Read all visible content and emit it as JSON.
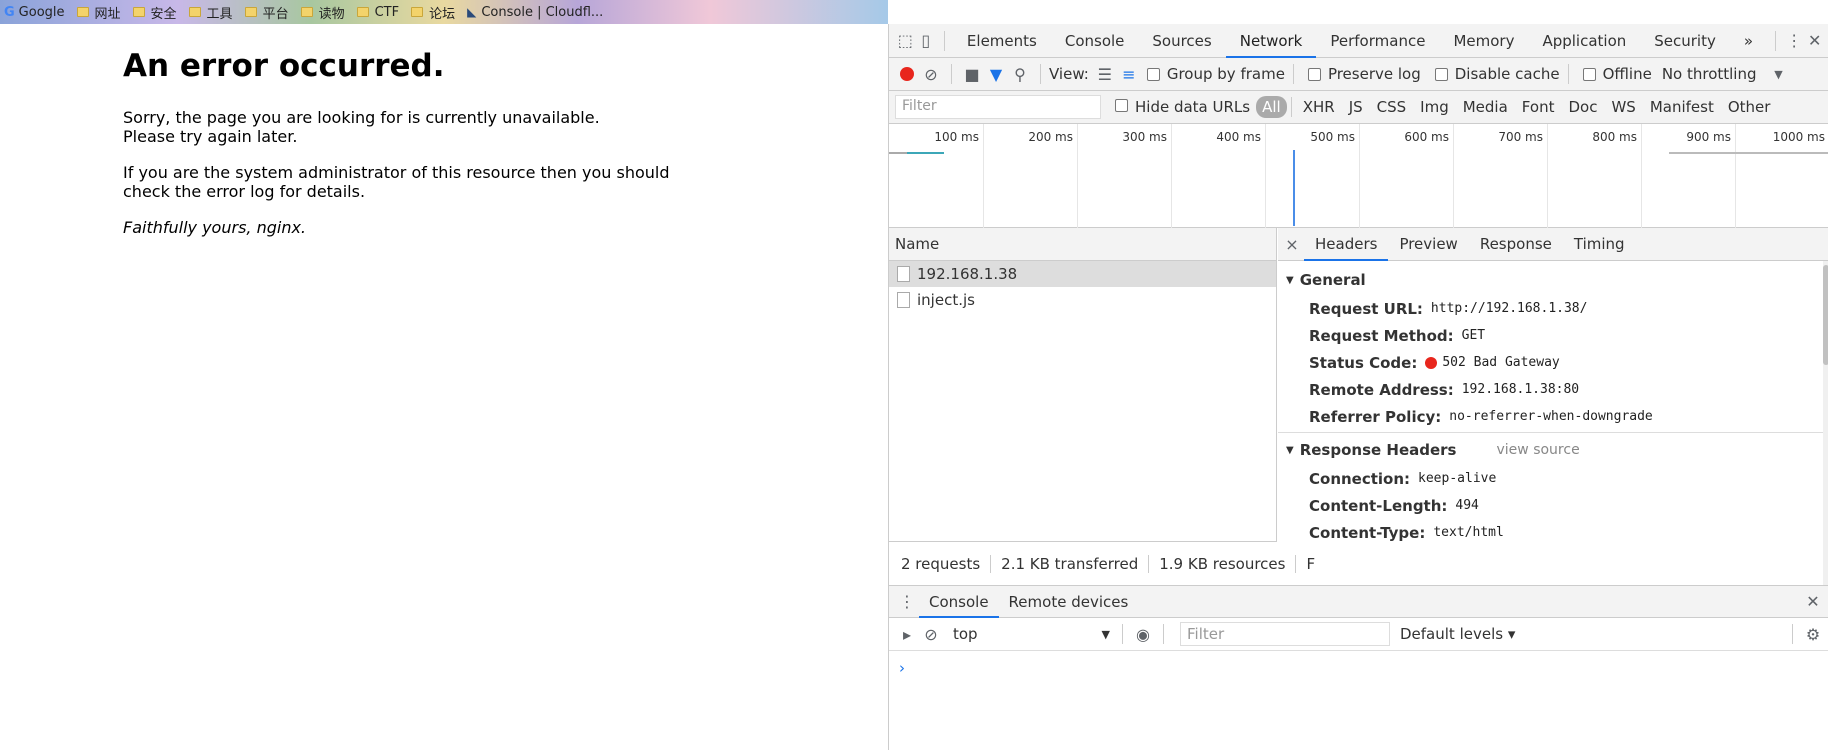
{
  "bookmarks": [
    {
      "label": "Google",
      "icon": "google-icon"
    },
    {
      "label": "网址",
      "icon": "folder-icon"
    },
    {
      "label": "安全",
      "icon": "folder-icon"
    },
    {
      "label": "工具",
      "icon": "folder-icon"
    },
    {
      "label": "平台",
      "icon": "folder-icon"
    },
    {
      "label": "读物",
      "icon": "folder-icon"
    },
    {
      "label": "CTF",
      "icon": "folder-icon"
    },
    {
      "label": "论坛",
      "icon": "folder-icon"
    },
    {
      "label": "Console | Cloudfl...",
      "icon": "cloudflare-icon"
    }
  ],
  "page": {
    "title": "An error occurred.",
    "p1": "Sorry, the page you are looking for is currently unavailable.",
    "p1b": "Please try again later.",
    "p2": "If you are the system administrator of this resource then you should check the error log for details.",
    "p3": "Faithfully yours, nginx."
  },
  "devtools": {
    "tabs": [
      "Elements",
      "Console",
      "Sources",
      "Network",
      "Performance",
      "Memory",
      "Application",
      "Security"
    ],
    "active_tab": "Network",
    "more": "»",
    "toolbar": {
      "view_label": "View:",
      "group_by_frame": "Group by frame",
      "preserve_log": "Preserve log",
      "disable_cache": "Disable cache",
      "offline": "Offline",
      "throttling": "No throttling"
    },
    "filter": {
      "placeholder": "Filter",
      "hide_data_urls": "Hide data URLs",
      "types": [
        "All",
        "XHR",
        "JS",
        "CSS",
        "Img",
        "Media",
        "Font",
        "Doc",
        "WS",
        "Manifest",
        "Other"
      ]
    },
    "timeline_ticks": [
      "100 ms",
      "200 ms",
      "300 ms",
      "400 ms",
      "500 ms",
      "600 ms",
      "700 ms",
      "800 ms",
      "900 ms",
      "1000 ms"
    ],
    "list": {
      "header": "Name",
      "items": [
        "192.168.1.38",
        "inject.js"
      ],
      "status": [
        "2 requests",
        "2.1 KB transferred",
        "1.9 KB resources",
        "F"
      ]
    },
    "detail": {
      "close": "×",
      "tabs": [
        "Headers",
        "Preview",
        "Response",
        "Timing"
      ],
      "general_title": "General",
      "general": [
        {
          "k": "Request URL:",
          "v": "http://192.168.1.38/"
        },
        {
          "k": "Request Method:",
          "v": "GET"
        },
        {
          "k": "Status Code:",
          "v": "502 Bad Gateway"
        },
        {
          "k": "Remote Address:",
          "v": "192.168.1.38:80"
        },
        {
          "k": "Referrer Policy:",
          "v": "no-referrer-when-downgrade"
        }
      ],
      "response_title": "Response Headers",
      "view_source": "view source",
      "response": [
        {
          "k": "Connection:",
          "v": "keep-alive"
        },
        {
          "k": "Content-Length:",
          "v": "494"
        },
        {
          "k": "Content-Type:",
          "v": "text/html"
        }
      ]
    },
    "drawer": {
      "tabs": [
        "Console",
        "Remote devices"
      ],
      "context": "top",
      "filter_placeholder": "Filter",
      "levels": "Default levels ▾",
      "prompt": "›"
    }
  },
  "colors": {
    "accent": "#1a73e8",
    "record": "#e8261d"
  }
}
